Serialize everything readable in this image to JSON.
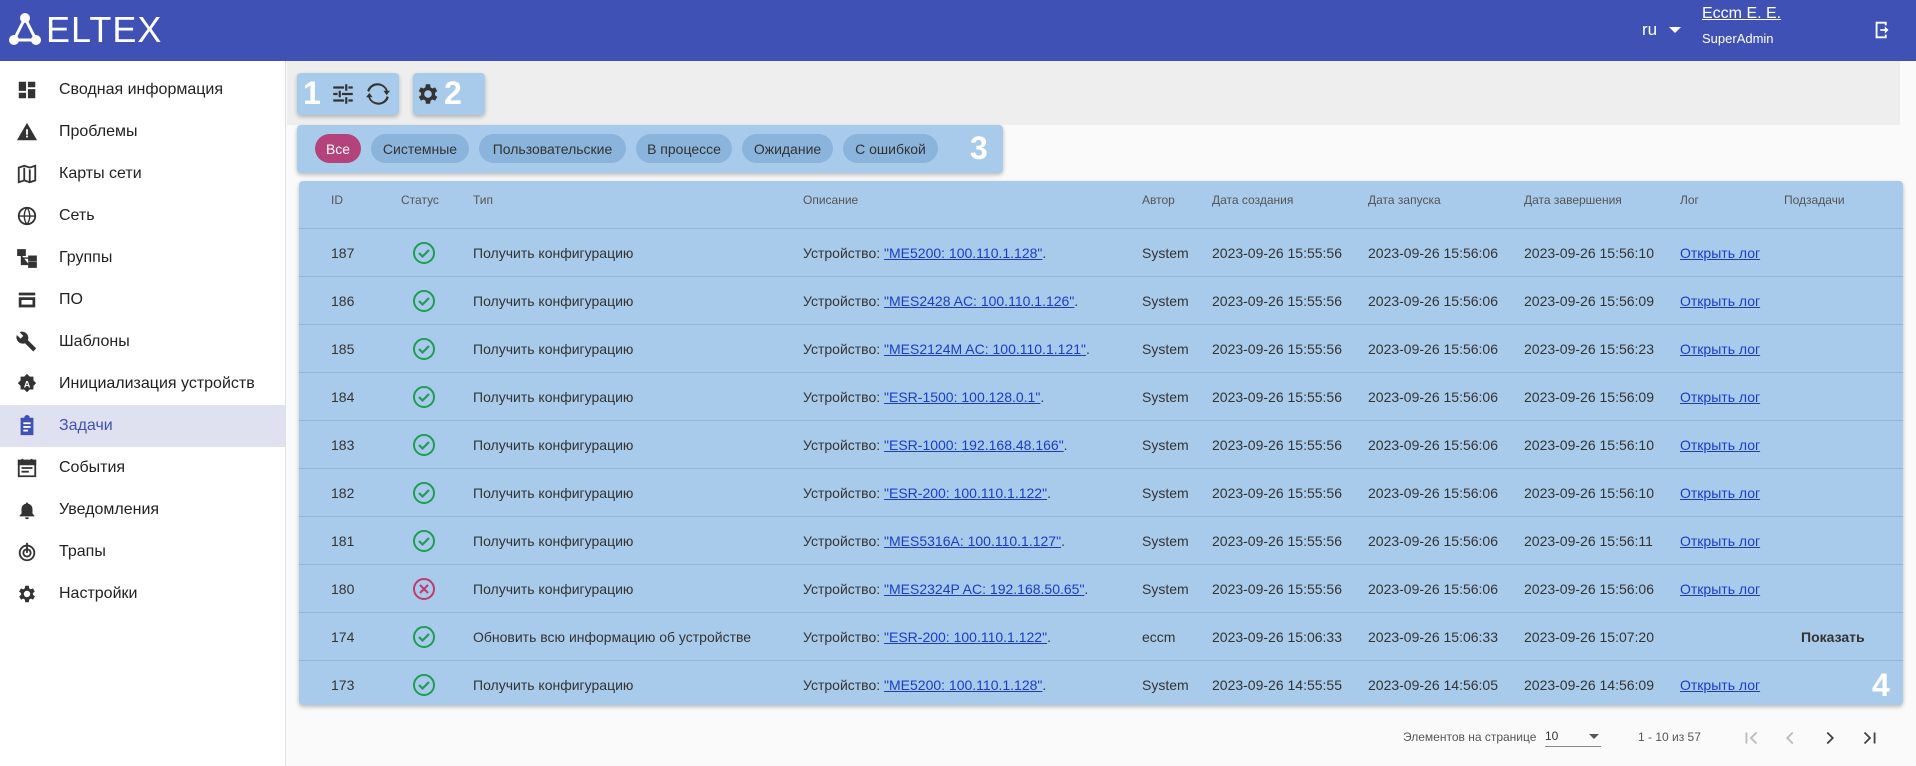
{
  "header": {
    "logo_text": "ELTEX",
    "lang": "ru",
    "user_name": "Eccm E. E.",
    "user_role": "SuperAdmin"
  },
  "sidebar": {
    "items": [
      {
        "label": "Сводная информация",
        "icon": "dashboard-icon"
      },
      {
        "label": "Проблемы",
        "icon": "warning-icon"
      },
      {
        "label": "Карты сети",
        "icon": "map-icon"
      },
      {
        "label": "Сеть",
        "icon": "globe-icon"
      },
      {
        "label": "Группы",
        "icon": "tree-icon"
      },
      {
        "label": "ПО",
        "icon": "store-icon"
      },
      {
        "label": "Шаблоны",
        "icon": "wrench-icon"
      },
      {
        "label": "Инициализация устройств",
        "icon": "auto-icon"
      },
      {
        "label": "Задачи",
        "icon": "clipboard-icon"
      },
      {
        "label": "События",
        "icon": "calendar-icon"
      },
      {
        "label": "Уведомления",
        "icon": "bell-icon"
      },
      {
        "label": "Трапы",
        "icon": "trap-icon"
      },
      {
        "label": "Настройки",
        "icon": "gear-icon"
      }
    ],
    "active_index": 8
  },
  "annotations": {
    "n1": "1",
    "n2": "2",
    "n3": "3",
    "n4": "4"
  },
  "filters": [
    "Все",
    "Системные",
    "Пользовательские",
    "В процессе",
    "Ожидание",
    "С ошибкой"
  ],
  "table": {
    "columns": [
      "ID",
      "Статус",
      "Тип",
      "Описание",
      "Автор",
      "Дата создания",
      "Дата запуска",
      "Дата завершения",
      "Лог",
      "Подзадачи"
    ],
    "desc_prefix": "Устройство: ",
    "rows": [
      {
        "id": "187",
        "status": "success",
        "type": "Получить конфигурацию",
        "device": "\"ME5200: 100.110.1.128\"",
        "author": "System",
        "created": "2023-09-26 15:55:56",
        "started": "2023-09-26 15:56:06",
        "finished": "2023-09-26 15:56:10",
        "log": "Открыть лог",
        "sub": ""
      },
      {
        "id": "186",
        "status": "success",
        "type": "Получить конфигурацию",
        "device": "\"MES2428 AC: 100.110.1.126\"",
        "author": "System",
        "created": "2023-09-26 15:55:56",
        "started": "2023-09-26 15:56:06",
        "finished": "2023-09-26 15:56:09",
        "log": "Открыть лог",
        "sub": ""
      },
      {
        "id": "185",
        "status": "success",
        "type": "Получить конфигурацию",
        "device": "\"MES2124M AC: 100.110.1.121\"",
        "author": "System",
        "created": "2023-09-26 15:55:56",
        "started": "2023-09-26 15:56:06",
        "finished": "2023-09-26 15:56:23",
        "log": "Открыть лог",
        "sub": ""
      },
      {
        "id": "184",
        "status": "success",
        "type": "Получить конфигурацию",
        "device": "\"ESR-1500: 100.128.0.1\"",
        "author": "System",
        "created": "2023-09-26 15:55:56",
        "started": "2023-09-26 15:56:06",
        "finished": "2023-09-26 15:56:09",
        "log": "Открыть лог",
        "sub": ""
      },
      {
        "id": "183",
        "status": "success",
        "type": "Получить конфигурацию",
        "device": "\"ESR-1000: 192.168.48.166\"",
        "author": "System",
        "created": "2023-09-26 15:55:56",
        "started": "2023-09-26 15:56:06",
        "finished": "2023-09-26 15:56:10",
        "log": "Открыть лог",
        "sub": ""
      },
      {
        "id": "182",
        "status": "success",
        "type": "Получить конфигурацию",
        "device": "\"ESR-200: 100.110.1.122\"",
        "author": "System",
        "created": "2023-09-26 15:55:56",
        "started": "2023-09-26 15:56:06",
        "finished": "2023-09-26 15:56:10",
        "log": "Открыть лог",
        "sub": ""
      },
      {
        "id": "181",
        "status": "success",
        "type": "Получить конфигурацию",
        "device": "\"MES5316A: 100.110.1.127\"",
        "author": "System",
        "created": "2023-09-26 15:55:56",
        "started": "2023-09-26 15:56:06",
        "finished": "2023-09-26 15:56:11",
        "log": "Открыть лог",
        "sub": ""
      },
      {
        "id": "180",
        "status": "error",
        "type": "Получить конфигурацию",
        "device": "\"MES2324P AC: 192.168.50.65\"",
        "author": "System",
        "created": "2023-09-26 15:55:56",
        "started": "2023-09-26 15:56:06",
        "finished": "2023-09-26 15:56:06",
        "log": "Открыть лог",
        "sub": ""
      },
      {
        "id": "174",
        "status": "success",
        "type": "Обновить всю информацию об устройстве",
        "device": "\"ESR-200: 100.110.1.122\"",
        "author": "eccm",
        "created": "2023-09-26 15:06:33",
        "started": "2023-09-26 15:06:33",
        "finished": "2023-09-26 15:07:20",
        "log": "",
        "sub": "Показать"
      },
      {
        "id": "173",
        "status": "success",
        "type": "Получить конфигурацию",
        "device": "\"ME5200: 100.110.1.128\"",
        "author": "System",
        "created": "2023-09-26 14:55:55",
        "started": "2023-09-26 14:56:05",
        "finished": "2023-09-26 14:56:09",
        "log": "Открыть лог",
        "sub": ""
      }
    ]
  },
  "pagination": {
    "per_page_label": "Элементов на странице",
    "per_page_value": "10",
    "range": "1 - 10 из 57"
  },
  "colors": {
    "header": "#3f51b5",
    "highlight": "#a9cbeb",
    "active_chip": "#b3437a",
    "success": "#1f9d55",
    "error": "#c0396b"
  }
}
